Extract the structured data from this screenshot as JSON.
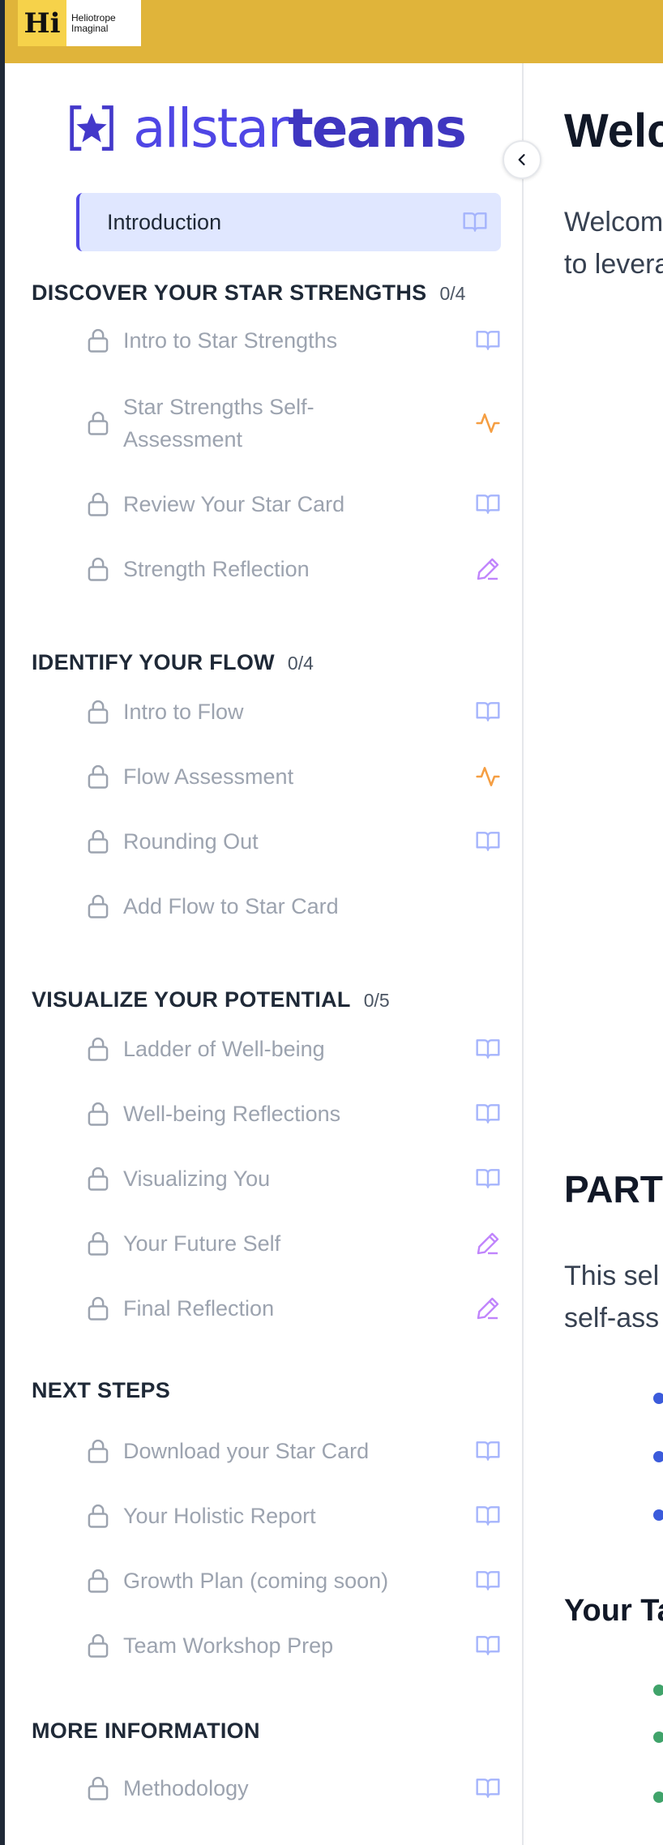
{
  "topbar": {
    "logo_letters": "Hi",
    "logo_line1": "Heliotrope",
    "logo_line2": "Imaginal"
  },
  "brand": {
    "name_light": "allstar",
    "name_bold": "teams"
  },
  "intro": {
    "label": "Introduction"
  },
  "sections": [
    {
      "title": "DISCOVER YOUR STAR STRENGTHS",
      "count": "0/4",
      "items": [
        {
          "label": "Intro to Star Strengths",
          "type": "book"
        },
        {
          "label": "Star Strengths Self-Assessment",
          "line1": "Star Strengths Self-",
          "line2": "Assessment",
          "type": "activity"
        },
        {
          "label": "Review Your Star Card",
          "type": "book"
        },
        {
          "label": "Strength Reflection",
          "type": "pencil"
        }
      ]
    },
    {
      "title": "IDENTIFY YOUR FLOW",
      "count": "0/4",
      "items": [
        {
          "label": "Intro to Flow",
          "type": "book"
        },
        {
          "label": "Flow Assessment",
          "type": "activity"
        },
        {
          "label": "Rounding Out",
          "type": "book"
        },
        {
          "label": "Add Flow to Star Card",
          "type": "none"
        }
      ]
    },
    {
      "title": "VISUALIZE YOUR POTENTIAL",
      "count": "0/5",
      "items": [
        {
          "label": "Ladder of Well-being",
          "type": "book"
        },
        {
          "label": "Well-being Reflections",
          "type": "book"
        },
        {
          "label": "Visualizing You",
          "type": "book"
        },
        {
          "label": "Your Future Self",
          "type": "pencil"
        },
        {
          "label": "Final Reflection",
          "type": "pencil"
        }
      ]
    },
    {
      "title": "NEXT STEPS",
      "count": "",
      "items": [
        {
          "label": "Download your Star Card",
          "type": "book"
        },
        {
          "label": "Your Holistic Report",
          "type": "book"
        },
        {
          "label": "Growth Plan (coming soon)",
          "type": "book"
        },
        {
          "label": "Team Workshop Prep",
          "type": "book"
        }
      ]
    },
    {
      "title": "MORE INFORMATION",
      "count": "",
      "items": [
        {
          "label": "Methodology",
          "type": "book"
        }
      ]
    }
  ],
  "main": {
    "title": "Welc",
    "para_line1": "Welcom",
    "para_line2": "to levera",
    "part_title": "PART",
    "part_line1": "This sel",
    "part_line2": "self-ass",
    "tasks_title": "Your Ta"
  },
  "colors": {
    "topbar": "#e0b43a",
    "accent": "#4f46e5",
    "active_bg": "#e0e7ff",
    "book_icon": "#a5b4fc",
    "activity_icon": "#f59e42",
    "pencil_icon": "#c084fc",
    "blue_bullet": "#3b5bdb",
    "green_bullet": "#40a36a"
  }
}
